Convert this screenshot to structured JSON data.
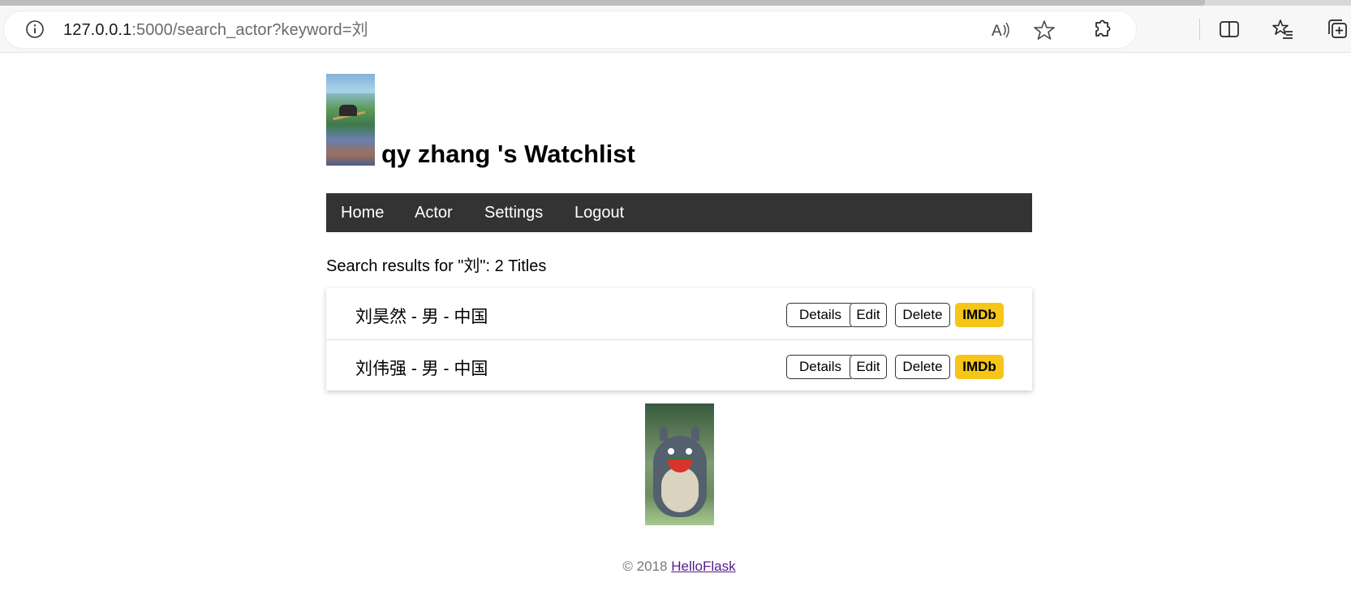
{
  "browser": {
    "url_host": "127.0.0.1",
    "url_rest": ":5000/search_actor?keyword=刘"
  },
  "header": {
    "title": "qy zhang 's Watchlist"
  },
  "nav": {
    "items": [
      {
        "label": "Home"
      },
      {
        "label": "Actor"
      },
      {
        "label": "Settings"
      },
      {
        "label": "Logout"
      }
    ]
  },
  "search": {
    "summary": "Search results for \"刘\": 2 Titles"
  },
  "results": [
    {
      "label": "刘昊然 - 男 - 中国",
      "details": "Details",
      "edit": "Edit",
      "delete": "Delete",
      "imdb": "IMDb"
    },
    {
      "label": "刘伟强 - 男 - 中国",
      "details": "Details",
      "edit": "Edit",
      "delete": "Delete",
      "imdb": "IMDb"
    }
  ],
  "footer": {
    "copyright": "© 2018",
    "link": "HelloFlask"
  },
  "colors": {
    "navbar_bg": "#333333",
    "imdb_yellow": "#f5c518",
    "footer_text": "#777777",
    "link_visited": "#551a8b"
  }
}
